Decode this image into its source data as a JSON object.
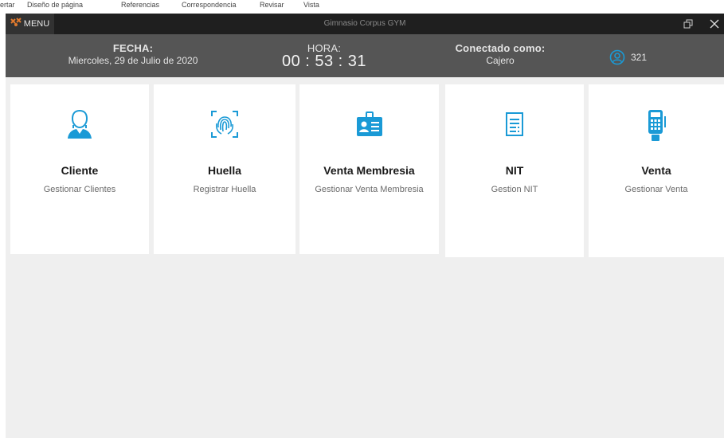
{
  "ribbon": {
    "items": [
      "ertar",
      "Diseño de página",
      "Referencias",
      "Correspondencia",
      "Revisar",
      "Vista"
    ]
  },
  "window": {
    "menu_label": "MENU",
    "title": "Gimnasio Corpus GYM"
  },
  "info": {
    "fecha_label": "FECHA:",
    "fecha_value": "Miercoles, 29 de Julio de 2020",
    "hora_label": "HORA:",
    "hora_value": "00 : 53 : 31",
    "conectado_label": "Conectado como:",
    "conectado_value": "Cajero",
    "user_id": "321"
  },
  "tiles": [
    {
      "title": "Cliente",
      "subtitle": "Gestionar Clientes",
      "icon": "user-icon"
    },
    {
      "title": "Huella",
      "subtitle": "Registrar Huella",
      "icon": "fingerprint-icon"
    },
    {
      "title": "Venta Membresia",
      "subtitle": "Gestionar Venta Membresia",
      "icon": "id-card-icon"
    },
    {
      "title": "NIT",
      "subtitle": "Gestion NIT",
      "icon": "document-icon"
    },
    {
      "title": "Venta",
      "subtitle": "Gestionar Venta",
      "icon": "pos-terminal-icon"
    }
  ],
  "colors": {
    "accent": "#1a9ad6",
    "titlebar": "#1f1f1f",
    "infobar": "#555555",
    "background": "#efefef",
    "menu_logo": "#e07a2e"
  }
}
